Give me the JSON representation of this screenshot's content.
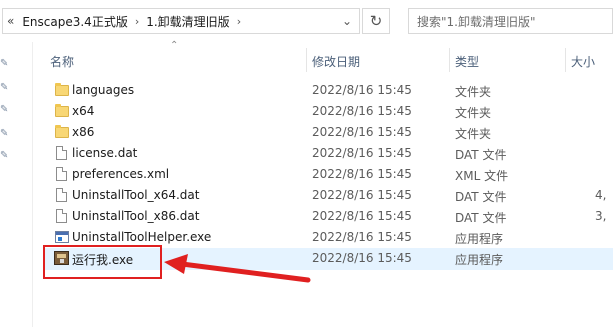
{
  "addressbar": {
    "back_glyph": "«",
    "breadcrumbs": [
      "Enscape3.4正式版",
      "1.卸载清理旧版"
    ],
    "separator": "›",
    "dropdown_glyph": "⌄",
    "refresh_glyph": "↻"
  },
  "search": {
    "placeholder": "搜索\"1.卸载清理旧版\""
  },
  "columns": {
    "name": "名称",
    "date": "修改日期",
    "type": "类型",
    "size": "大小"
  },
  "files": [
    {
      "name": "languages",
      "date": "2022/8/16 15:45",
      "type": "文件夹",
      "size": "",
      "icon": "folder-icon"
    },
    {
      "name": "x64",
      "date": "2022/8/16 15:45",
      "type": "文件夹",
      "size": "",
      "icon": "folder-icon"
    },
    {
      "name": "x86",
      "date": "2022/8/16 15:45",
      "type": "文件夹",
      "size": "",
      "icon": "folder-icon"
    },
    {
      "name": "license.dat",
      "date": "2022/8/16 15:45",
      "type": "DAT 文件",
      "size": "",
      "icon": "file-icon"
    },
    {
      "name": "preferences.xml",
      "date": "2022/8/16 15:45",
      "type": "XML 文件",
      "size": "",
      "icon": "file-icon"
    },
    {
      "name": "UninstallTool_x64.dat",
      "date": "2022/8/16 15:45",
      "type": "DAT 文件",
      "size": "4,",
      "icon": "file-icon"
    },
    {
      "name": "UninstallTool_x86.dat",
      "date": "2022/8/16 15:45",
      "type": "DAT 文件",
      "size": "3,",
      "icon": "file-icon"
    },
    {
      "name": "UninstallToolHelper.exe",
      "date": "2022/8/16 15:45",
      "type": "应用程序",
      "size": "",
      "icon": "exe-icon"
    },
    {
      "name": "运行我.exe",
      "date": "2022/8/16 15:45",
      "type": "应用程序",
      "size": "",
      "icon": "installer-box-icon"
    }
  ],
  "colors": {
    "accent_red": "#e02020",
    "selection": "#e5f3ff",
    "header_text": "#4c607a"
  }
}
